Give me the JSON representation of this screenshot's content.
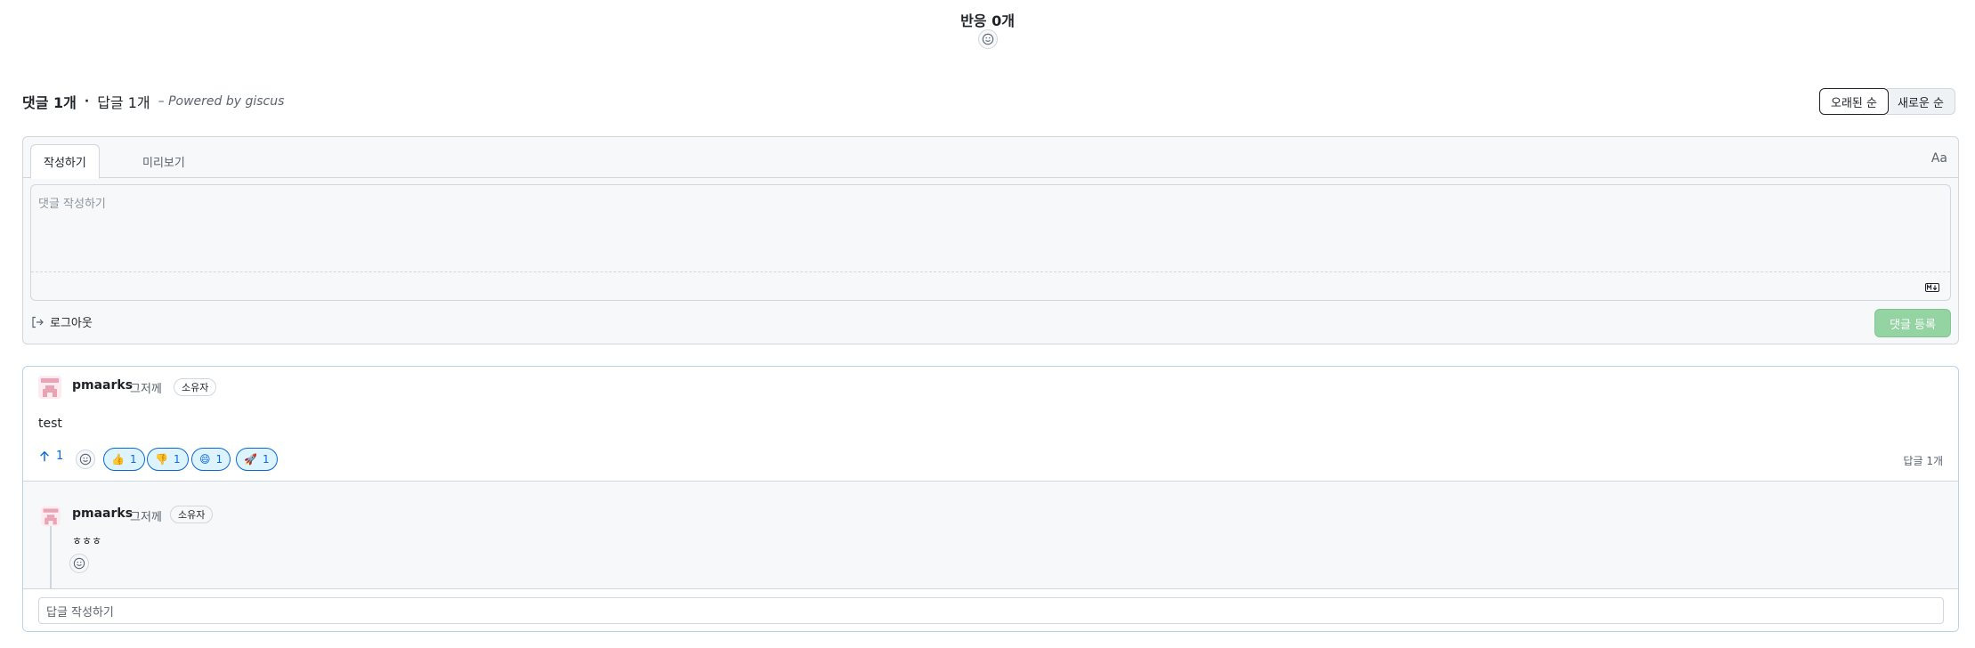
{
  "reactions": {
    "title": "반응 0개",
    "emoji_icon": "smile-icon"
  },
  "summary": {
    "comments": "댓글 1개",
    "separator": "·",
    "replies": "답글 1개",
    "powered_by": "– Powered by giscus"
  },
  "sort": {
    "oldest": "오래된 순",
    "newest": "새로운 순",
    "selected": "오래된 순"
  },
  "editor": {
    "tabs": [
      {
        "label": "작성하기",
        "active": true
      },
      {
        "label": "미리보기",
        "active": false
      }
    ],
    "font_toggle": "Aa",
    "placeholder": "댓글 작성하기",
    "markdown_icon": "markdown-icon",
    "logout_label": "로그아웃",
    "logout_icon": "sign-out-icon",
    "submit_label": "댓글 등록"
  },
  "comment": {
    "author": "pmaarks",
    "time": "그저께",
    "badge": "소유자",
    "body": "test",
    "upvotes": "1",
    "reactions": [
      {
        "emoji": "👍",
        "count": "1"
      },
      {
        "emoji": "👎",
        "count": "1"
      },
      {
        "emoji": "😄",
        "count": "1"
      },
      {
        "emoji": "🚀",
        "count": "1"
      }
    ],
    "reply_count": "답글 1개"
  },
  "reply": {
    "author": "pmaarks",
    "time": "그저께",
    "badge": "소유자",
    "body": "ㅎㅎㅎ"
  },
  "reply_input": {
    "placeholder": "답글 작성하기"
  },
  "colors": {
    "accent": "#0969da",
    "submit_disabled": "#94d3a2",
    "border": "#d0d7de",
    "thread_border": "#b6d3f0"
  }
}
